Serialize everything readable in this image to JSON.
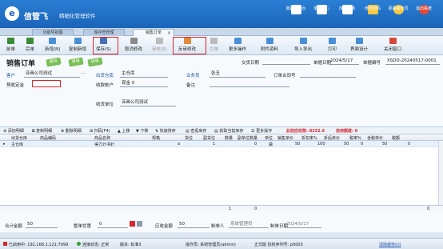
{
  "app": {
    "brand": "信管飞",
    "brand_sub": "精细化管理软件",
    "top_buttons": [
      "我的工作台",
      "单据中心",
      "库存查询",
      "修改密码",
      "更换操作员",
      "退出系统"
    ]
  },
  "tabs": [
    "功能导航图",
    "库存查管理",
    "销售订单"
  ],
  "toolbar": {
    "buttons": [
      "前单",
      "后单",
      "新增(N)",
      "复制新增",
      "保存(S)",
      "取消修改",
      "审核(E)",
      "反审修改",
      "引单",
      "更多操作",
      "附件资料",
      "导入导出",
      "打印",
      "界面设计",
      "关闭窗口"
    ]
  },
  "form": {
    "title": "销售订单",
    "stamps": [
      "保存",
      "审核",
      "待审"
    ],
    "doc_date_label": "交货日期",
    "doc_date_value": "",
    "order_date_label": "单据日期",
    "order_date_value": "2024/5/17",
    "order_no_label": "单据编号",
    "order_no_value": "XSDD-20240517-0001",
    "customer_label": "客户",
    "customer_value": "亚画公司测试",
    "deposit_label": "预收定金",
    "deposit_value": "",
    "warehouse_label": "出货仓库",
    "warehouse_value": "主仓库",
    "account_label": "收款帐户",
    "account_value": "现金 0",
    "salesman_label": "业务员",
    "salesman_value": "张丑",
    "contract_label": "订单合同号",
    "contract_value": "",
    "remark_label": "备注",
    "remark_value": "",
    "receiver_label": "收货单位",
    "receiver_value": "亚画公司测试"
  },
  "detail_toolbar": {
    "items": [
      "添加明细",
      "复制明细",
      "删除明细",
      "扫码(F4)",
      "上移",
      "下移",
      "快速排序",
      "查看库存",
      "获取当前库存",
      "更多操作"
    ],
    "profit_label": "此前应收款: 8252.9",
    "credit_label": "信用额度: 0"
  },
  "grid": {
    "headers": [
      "出货仓库",
      "商品编码",
      "商品名称",
      "规格",
      "货位",
      "副货位",
      "数量",
      "副单位数量",
      "单位",
      "销售单价",
      "折扣率%",
      "折后单价",
      "税率%",
      "含税单价",
      "税额"
    ],
    "rows": [
      [
        "主仓库",
        "",
        "得力计书针",
        "",
        "a",
        "",
        "1",
        "0",
        "袋",
        "50",
        "100",
        "50",
        "0",
        "50",
        "0"
      ]
    ],
    "sum_qty": "1",
    "sum_amount": "0",
    "sum_right": "0"
  },
  "totals": {
    "total_amount_label": "合计金额",
    "total_amount_value": "50",
    "discount_label": "整单优惠",
    "discount_value": "0",
    "receivable_label": "应收金额",
    "receivable_value": "50",
    "maker_label": "制单人",
    "maker_value": "系统管理员",
    "make_date_label": "制单日期",
    "make_date_value": "2024/5/17"
  },
  "statusbar": {
    "server": "已启用中: 192.168.1.121:7099",
    "conn": "连接状态: 正常",
    "version": "版本: 标准3",
    "operator": "操作员: 系统管理员(admin)",
    "license": "正式版 授权序列号: p0003",
    "update": "清除缓存(U)"
  },
  "colors": {
    "title_bar": "#1a64b8",
    "highlight": "#d6262d",
    "label_blue": "#2155a8",
    "stamp_green": "#7bbf55"
  }
}
